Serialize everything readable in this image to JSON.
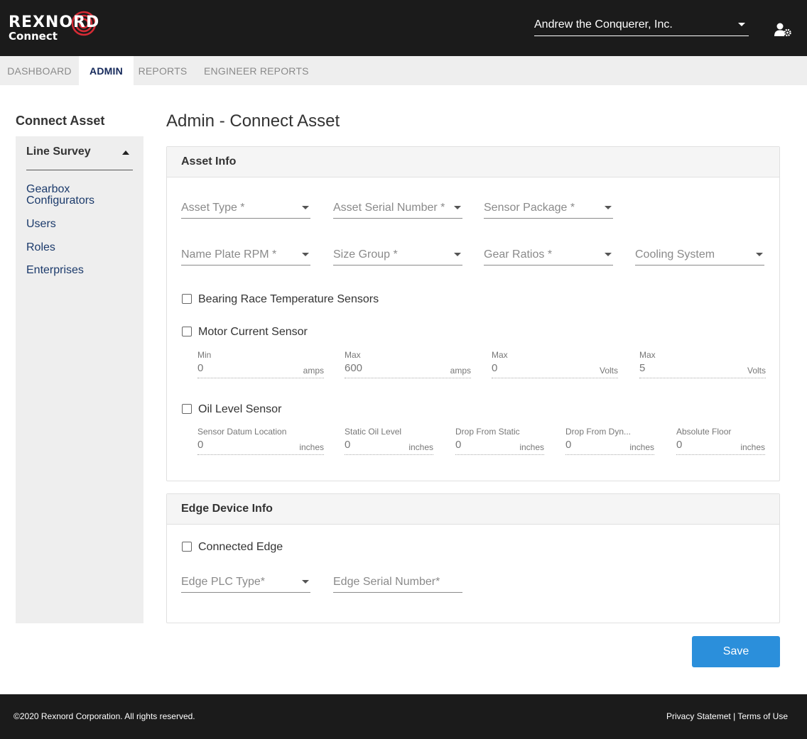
{
  "header": {
    "logo_text": "REXNORD",
    "logo_sub": "Connect",
    "organization": "Andrew the Conquerer, Inc."
  },
  "tabs": [
    {
      "label": "DASHBOARD",
      "active": false
    },
    {
      "label": "ADMIN",
      "active": true
    },
    {
      "label": "REPORTS",
      "active": false
    },
    {
      "label": "ENGINEER REPORTS",
      "active": false
    }
  ],
  "sidebar": {
    "title": "Connect Asset",
    "section": "Line Survey",
    "items": [
      {
        "label": "Gearbox Configurators"
      },
      {
        "label": "Users"
      },
      {
        "label": "Roles"
      },
      {
        "label": "Enterprises"
      }
    ]
  },
  "page": {
    "title": "Admin - Connect Asset"
  },
  "asset_info": {
    "heading": "Asset Info",
    "selects_row1": [
      "Asset Type *",
      "Asset Serial Number *",
      "Sensor Package *"
    ],
    "selects_row2": [
      "Name Plate RPM *",
      "Size Group *",
      "Gear Ratios *",
      "Cooling System"
    ],
    "bearing_label": "Bearing Race Temperature Sensors",
    "motor_label": "Motor Current Sensor",
    "motor_fields": [
      {
        "caption": "Min",
        "value": "0",
        "unit": "amps"
      },
      {
        "caption": "Max",
        "value": "600",
        "unit": "amps"
      },
      {
        "caption": "Max",
        "value": "0",
        "unit": "Volts"
      },
      {
        "caption": "Max",
        "value": "5",
        "unit": "Volts"
      }
    ],
    "oil_label": "Oil Level Sensor",
    "oil_fields": [
      {
        "caption": "Sensor Datum Location",
        "value": "0",
        "unit": "inches"
      },
      {
        "caption": "Static Oil Level",
        "value": "0",
        "unit": "inches"
      },
      {
        "caption": "Drop From Static",
        "value": "0",
        "unit": "inches"
      },
      {
        "caption": "Drop From Dyn...",
        "value": "0",
        "unit": "inches"
      },
      {
        "caption": "Absolute Floor",
        "value": "0",
        "unit": "inches"
      }
    ]
  },
  "edge_info": {
    "heading": "Edge Device Info",
    "connected_label": "Connected Edge",
    "plc_type": "Edge PLC Type*",
    "serial_number": "Edge Serial Number*"
  },
  "actions": {
    "save_label": "Save"
  },
  "footer": {
    "copyright": "©2020 Rexnord Corporation. All rights reserved.",
    "privacy": "Privacy Statemet",
    "separator": "|",
    "terms": "Terms of Use"
  },
  "colors": {
    "header_bg": "#1b1b1b",
    "accent": "#2b8fdb",
    "link": "#1b3a6b",
    "logo_ring": "#d62b35"
  }
}
